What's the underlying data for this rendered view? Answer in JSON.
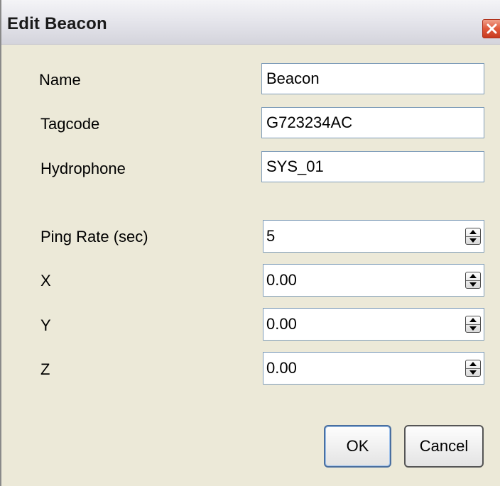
{
  "window": {
    "title": "Edit Beacon",
    "close_icon": "close-icon",
    "colors": {
      "titlebar": "#e6e6ec",
      "body": "#ece9d8",
      "close_button": "#e0583a",
      "field_border": "#7f9db9"
    }
  },
  "form": {
    "name": {
      "label": "Name",
      "value": "Beacon"
    },
    "tagcode": {
      "label": "Tagcode",
      "value": "G723234AC"
    },
    "hydrophone": {
      "label": "Hydrophone",
      "value": "SYS_01"
    },
    "ping_rate": {
      "label": "Ping Rate (sec)",
      "value": "5"
    },
    "x": {
      "label": "X",
      "value": "0.00"
    },
    "y": {
      "label": "Y",
      "value": "0.00"
    },
    "z": {
      "label": "Z",
      "value": "0.00"
    }
  },
  "buttons": {
    "ok": "OK",
    "cancel": "Cancel"
  }
}
